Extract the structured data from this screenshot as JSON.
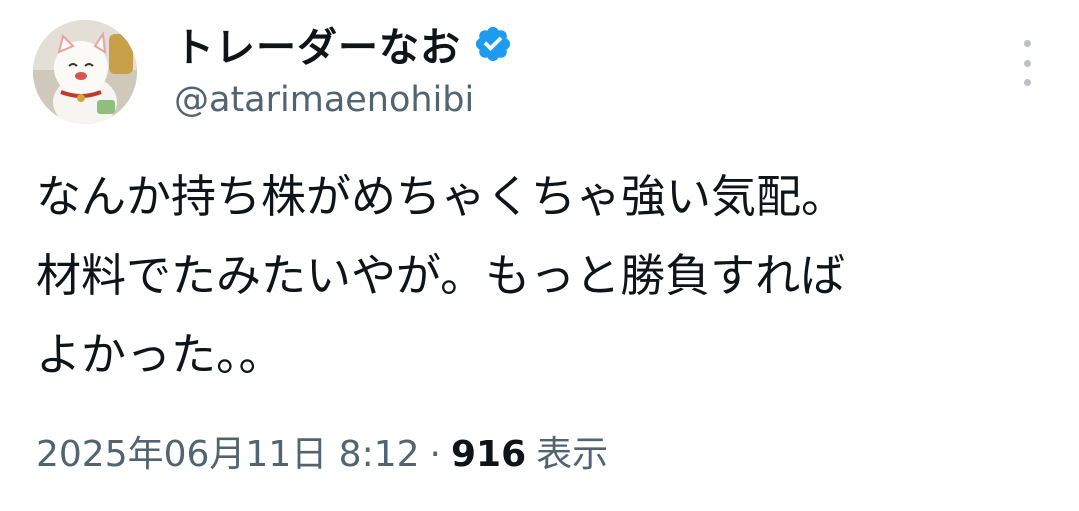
{
  "user": {
    "display_name": "トレーダーなお",
    "handle": "@atarimaenohibi",
    "verified_icon": "verified-badge-icon",
    "verified_color": "#1d9bf0",
    "avatar_icon": "maneki-neko-avatar"
  },
  "tweet": {
    "lines": [
      "なんか持ち株がめちゃくちゃ強い気配。",
      "材料でたみたいやが。もっと勝負すれば",
      "よかった。。"
    ]
  },
  "meta": {
    "date": "2025年06月11日 8:12",
    "separator": "·",
    "views_count": "916",
    "views_label": "表示"
  },
  "menu": {
    "icon": "more-vertical-icon"
  }
}
